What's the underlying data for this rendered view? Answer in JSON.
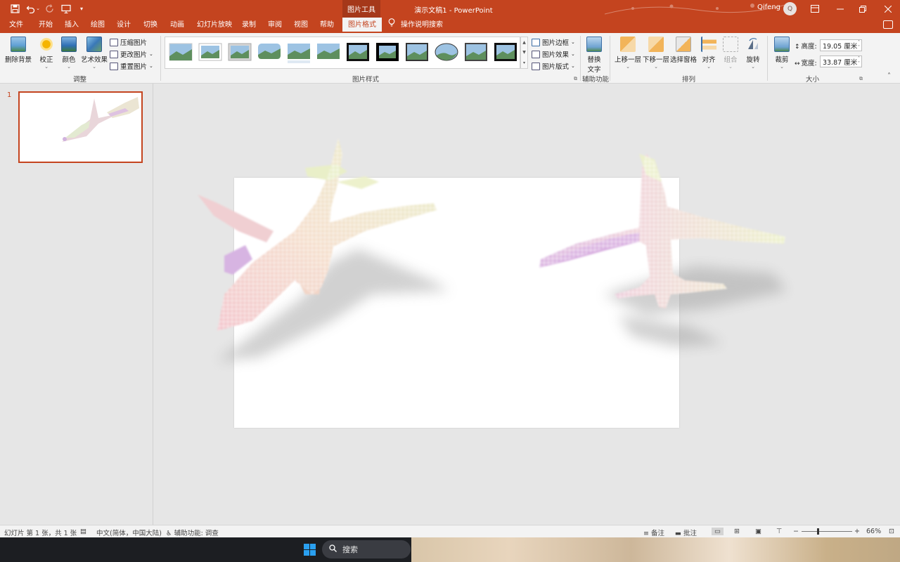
{
  "titlebar": {
    "context_group": "图片工具",
    "doc_title": "演示文稿1  -  PowerPoint",
    "user_name": "Qifeng",
    "avatar_initial": "Q"
  },
  "tabs": [
    "文件",
    "开始",
    "插入",
    "绘图",
    "设计",
    "切换",
    "动画",
    "幻灯片放映",
    "录制",
    "审阅",
    "视图",
    "帮助",
    "图片格式"
  ],
  "active_tab": "图片格式",
  "tell_me": "操作说明搜索",
  "ribbon": {
    "adjust": {
      "remove_bg": "删除背景",
      "corrections": "校正",
      "color": "颜色",
      "artistic": "艺术效果",
      "compress": "压缩图片",
      "change": "更改图片",
      "reset": "重置图片",
      "label": "调整"
    },
    "styles": {
      "label": "图片样式",
      "border": "图片边框",
      "effects": "图片效果",
      "layout": "图片版式"
    },
    "accessibility": {
      "alt_text_line1": "替换",
      "alt_text_line2": "文字",
      "label": "辅助功能"
    },
    "arrange": {
      "bring_forward": "上移一层",
      "send_backward": "下移一层",
      "selection_pane": "选择窗格",
      "align": "对齐",
      "group": "组合",
      "rotate": "旋转",
      "label": "排列"
    },
    "size": {
      "crop": "裁剪",
      "height_label": "高度:",
      "height_value": "19.05 厘米",
      "width_label": "宽度:",
      "width_value": "33.87 厘米",
      "label": "大小"
    }
  },
  "slides_pane": {
    "slide_number": "1"
  },
  "statusbar": {
    "slide_info": "幻灯片 第 1 张，共 1 张",
    "language": "中文(简体，中国大陆)",
    "accessibility": "辅助功能: 调查",
    "notes": "备注",
    "comments": "批注",
    "zoom": "66%"
  },
  "taskbar": {
    "search": "搜索"
  },
  "colors": {
    "accent": "#c4441f",
    "ribbon_bg": "#f3f3f3"
  }
}
